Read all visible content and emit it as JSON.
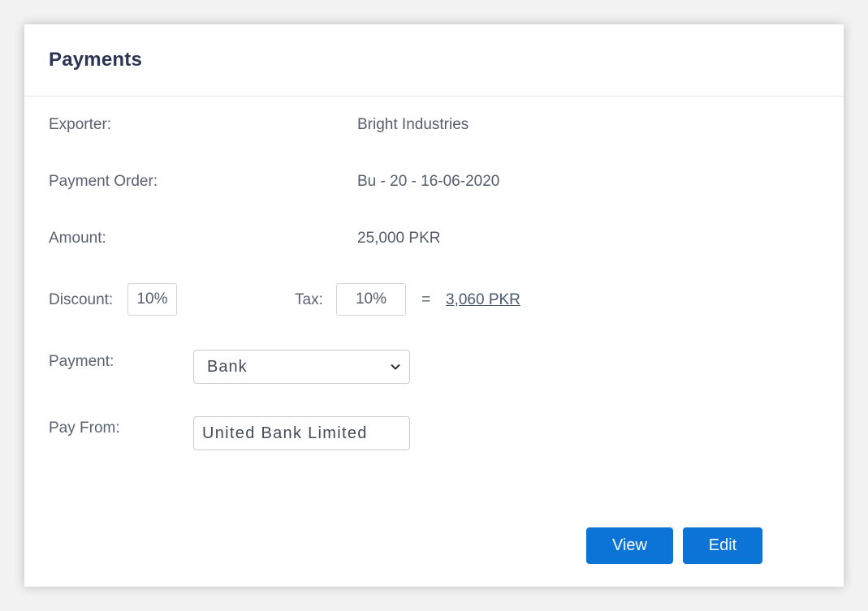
{
  "title": "Payments",
  "fields": {
    "exporter_label": "Exporter:",
    "exporter_value": "Bright Industries",
    "payment_order_label": "Payment Order:",
    "payment_order_value": "Bu - 20 - 16-06-2020",
    "amount_label": "Amount:",
    "amount_value": "25,000 PKR",
    "discount_label": "Discount:",
    "discount_value": "10%",
    "tax_label": "Tax:",
    "tax_value": "10%",
    "equals": "=",
    "total_value": "3,060 PKR",
    "payment_label": "Payment:",
    "payment_method": "Bank",
    "pay_from_label": "Pay From:",
    "pay_from_value": "United Bank Limited"
  },
  "buttons": {
    "view": "View",
    "edit": "Edit"
  },
  "colors": {
    "primary": "#0b74d6",
    "title": "#2d3554",
    "text": "#5a6170"
  },
  "icons": {
    "select_arrow": "chevron-down-icon"
  }
}
